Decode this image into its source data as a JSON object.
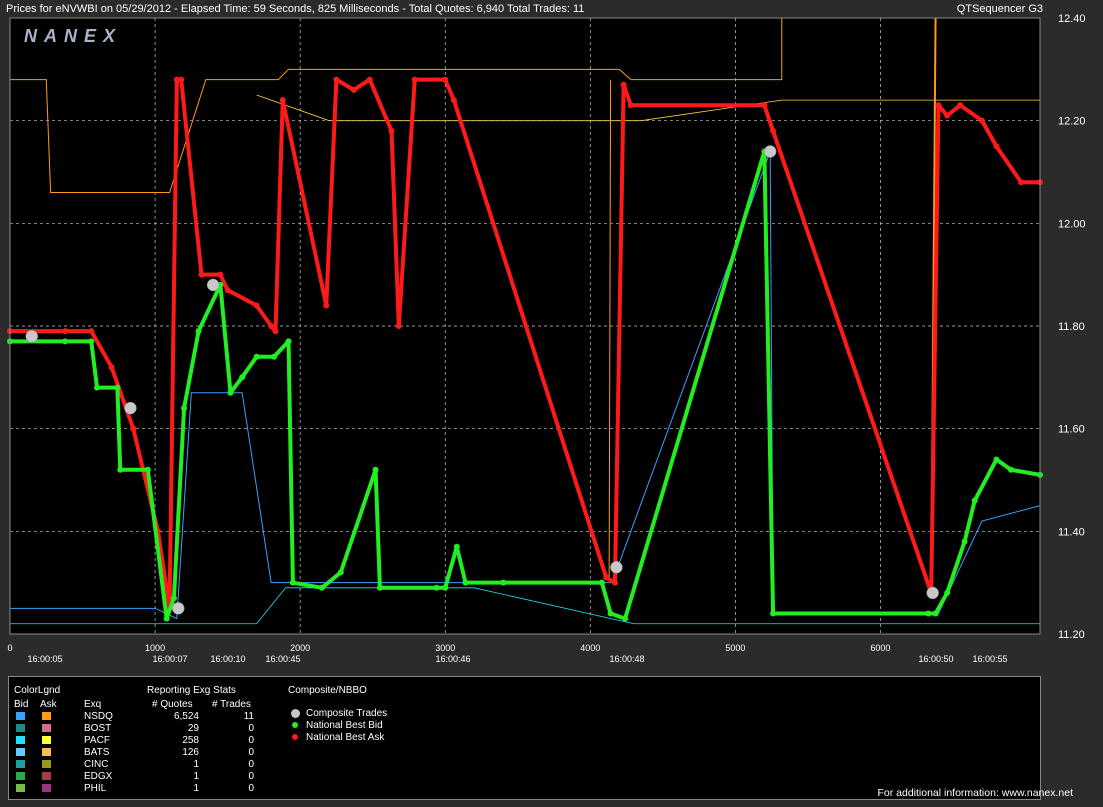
{
  "title": {
    "left": "Prices for  eNVWBI  on  05/29/2012  -  Elapsed Time: 59 Seconds, 825 Milliseconds  -  Total Quotes: 6,940  Total Trades: 11",
    "right": "QTSequencer G3"
  },
  "logo": "NANEX",
  "chart_data": {
    "type": "line",
    "ylim": [
      11.2,
      12.4
    ],
    "xlim": [
      0,
      7100
    ],
    "y_ticks": [
      "12.40",
      "12.20",
      "12.00",
      "11.80",
      "11.60",
      "11.40",
      "11.20"
    ],
    "x_ticks": [
      "0",
      "1000",
      "2000",
      "3000",
      "4000",
      "5000",
      "6000"
    ],
    "time_labels": [
      "16:00:05",
      "16:00:07",
      "16:00:10",
      "16:00:45",
      "16:00:46",
      "16:00:48",
      "16:00:50",
      "16:00:55"
    ],
    "grid": true,
    "series": [
      {
        "name": "National Best Ask",
        "color": "#ff1a1a",
        "x": [
          0,
          380,
          560,
          700,
          850,
          1020,
          1100,
          1150,
          1180,
          1320,
          1450,
          1500,
          1700,
          1800,
          1830,
          1880,
          2180,
          2250,
          2370,
          2480,
          2630,
          2680,
          2790,
          3000,
          3060,
          4110,
          4170,
          4230,
          4280,
          5200,
          5260,
          6350,
          6400,
          6460,
          6550,
          6700,
          6800,
          6970,
          7100
        ],
        "y": [
          11.79,
          11.79,
          11.79,
          11.72,
          11.6,
          11.4,
          11.25,
          12.28,
          12.28,
          11.9,
          11.9,
          11.87,
          11.84,
          11.8,
          11.79,
          12.24,
          11.84,
          12.28,
          12.26,
          12.28,
          12.18,
          11.8,
          12.28,
          12.28,
          12.24,
          11.31,
          11.3,
          12.27,
          12.23,
          12.23,
          12.18,
          11.28,
          12.23,
          12.21,
          12.23,
          12.2,
          12.15,
          12.08,
          12.08
        ]
      },
      {
        "name": "National Best Bid",
        "color": "#22ee22",
        "x": [
          0,
          380,
          560,
          600,
          740,
          760,
          950,
          1080,
          1130,
          1200,
          1300,
          1450,
          1520,
          1600,
          1700,
          1820,
          1920,
          1950,
          2150,
          2280,
          2520,
          2550,
          2940,
          3000,
          3080,
          3140,
          3400,
          4080,
          4140,
          4240,
          5200,
          5260,
          6330,
          6380,
          6460,
          6580,
          6650,
          6800,
          6900,
          7100
        ],
        "y": [
          11.77,
          11.77,
          11.77,
          11.68,
          11.68,
          11.52,
          11.52,
          11.23,
          11.27,
          11.64,
          11.79,
          11.88,
          11.67,
          11.7,
          11.74,
          11.74,
          11.77,
          11.3,
          11.29,
          11.32,
          11.52,
          11.29,
          11.29,
          11.29,
          11.37,
          11.3,
          11.3,
          11.3,
          11.24,
          11.23,
          12.14,
          11.24,
          11.24,
          11.24,
          11.28,
          11.38,
          11.46,
          11.54,
          11.52,
          11.51
        ]
      },
      {
        "name": "Composite Trades",
        "color": "#c8c8c8",
        "x": [
          150,
          830,
          1160,
          1400,
          4180,
          6360,
          5240
        ],
        "y": [
          11.78,
          11.64,
          11.25,
          11.88,
          11.33,
          11.28,
          12.14
        ]
      }
    ],
    "legend": {
      "color_legend_title": "ColorLgnd",
      "bid_header": "Bid",
      "ask_header": "Ask",
      "exq_header": "Exq",
      "stats_title": "Reporting Exg Stats",
      "quotes_header": "# Quotes",
      "trades_header": "# Trades",
      "composite_title": "Composite/NBBO",
      "rows": [
        {
          "exq": "NSDQ",
          "quotes": "6,524",
          "trades": "11",
          "bid_color": "#3aa0ff",
          "ask_color": "#ff9a1a"
        },
        {
          "exq": "BOST",
          "quotes": "29",
          "trades": "0",
          "bid_color": "#1e8a8a",
          "ask_color": "#d0708a"
        },
        {
          "exq": "PACF",
          "quotes": "258",
          "trades": "0",
          "bid_color": "#22e0ff",
          "ask_color": "#ffff33"
        },
        {
          "exq": "BATS",
          "quotes": "126",
          "trades": "0",
          "bid_color": "#66ccff",
          "ask_color": "#ffbb55"
        },
        {
          "exq": "CINC",
          "quotes": "1",
          "trades": "0",
          "bid_color": "#1f9e9e",
          "ask_color": "#9a9a1a"
        },
        {
          "exq": "EDGX",
          "quotes": "1",
          "trades": "0",
          "bid_color": "#2aa84a",
          "ask_color": "#a04040"
        },
        {
          "exq": "PHIL",
          "quotes": "1",
          "trades": "0",
          "bid_color": "#7aba4a",
          "ask_color": "#a03080"
        }
      ],
      "nbbo": [
        {
          "label": "Composite Trades",
          "color": "#c8c8c8"
        },
        {
          "label": "National Best Bid",
          "color": "#22ee22"
        },
        {
          "label": "National Best Ask",
          "color": "#ff1a1a"
        }
      ]
    }
  },
  "footer": "For additional information: www.nanex.net"
}
